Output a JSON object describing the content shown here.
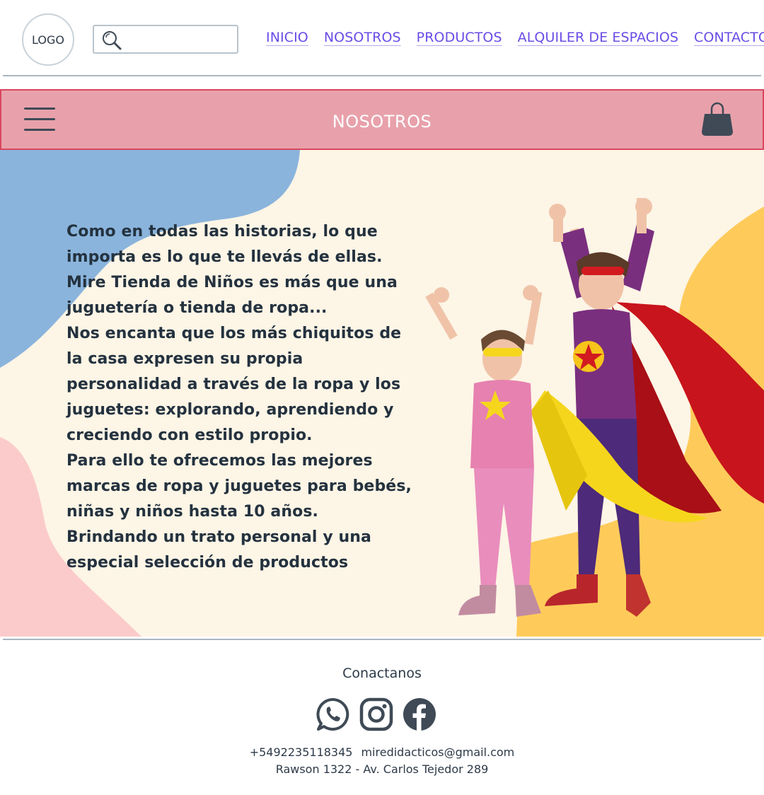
{
  "header": {
    "logo_text": "LOGO",
    "search": {
      "value": "",
      "icon": "search-icon"
    },
    "nav": [
      {
        "label": "INICIO"
      },
      {
        "label": "NOSOTROS"
      },
      {
        "label": "PRODUCTOS"
      },
      {
        "label": "ALQUILER DE ESPACIOS"
      },
      {
        "label": "CONTACTO"
      }
    ],
    "link_color": "#6a4ce6"
  },
  "title_bar": {
    "title": "NOSOTROS",
    "menu_icon": "hamburger-menu-icon",
    "cart_icon": "shopping-bag-icon",
    "background": "#e8a1ab",
    "border_color": "#d9465e"
  },
  "about": {
    "paragraphs": [
      "Como en todas las historias, lo que importa es lo que te llevás de ellas.",
      "Mire Tienda de Niños es más que una juguetería o tienda de ropa...",
      "Nos encanta que los más chiquitos de la casa expresen su propia personalidad a través de la ropa y los juguetes: explorando,  aprendiendo y creciendo con estilo propio.",
      "Para ello te ofrecemos las mejores marcas de ropa y juguetes para bebés, niñas y niños hasta 10 años.",
      "Brindando un trato personal y una especial selección de productos"
    ],
    "colors": {
      "background": "#fdf5e6",
      "blue_blob": "#8ab4dc",
      "pink_blob": "#fbcbcb",
      "yellow_blob": "#fecb5a"
    }
  },
  "footer": {
    "heading": "Conactanos",
    "socials": [
      {
        "icon": "whatsapp-icon"
      },
      {
        "icon": "instagram-icon"
      },
      {
        "icon": "facebook-icon"
      }
    ],
    "phone": "+5492235118345",
    "email": "miredidacticos@gmail.com",
    "address": "Rawson 1322 - Av. Carlos Tejedor 289"
  }
}
